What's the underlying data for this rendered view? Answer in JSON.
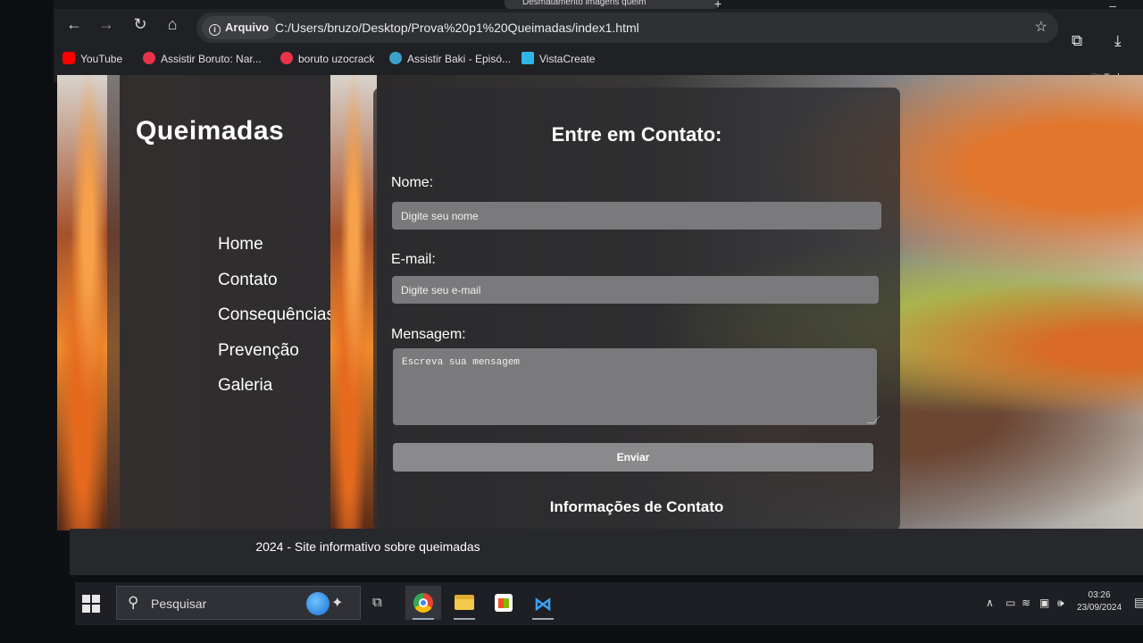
{
  "browser": {
    "tab_title": "Desmatamento imagens queim",
    "security_chip": "Arquivo",
    "url": "C:/Users/bruzo/Desktop/Prova%20p1%20Queimadas/index1.html",
    "bookmarks": [
      {
        "label": "YouTube",
        "color": "#ff0000"
      },
      {
        "label": "Assistir Boruto: Nar...",
        "color": "#e8334a"
      },
      {
        "label": "boruto uzocrack",
        "color": "#e8334a"
      },
      {
        "label": "Assistir Baki - Episó...",
        "color": "#3ba3c9"
      },
      {
        "label": "VistaCreate",
        "color": "#2fb5e8"
      }
    ],
    "other_bookmarks": "Todos os"
  },
  "site": {
    "logo": "Queimadas",
    "nav": [
      "Home",
      "Contato",
      "Consequências",
      "Prevenção",
      "Galeria"
    ],
    "form": {
      "title": "Entre em Contato:",
      "name_label": "Nome:",
      "name_placeholder": "Digite seu nome",
      "email_label": "E-mail:",
      "email_placeholder": "Digite seu e-mail",
      "message_label": "Mensagem:",
      "message_placeholder": "Escreva sua mensagem",
      "submit_label": "Enviar"
    },
    "info_title": "Informações de Contato",
    "footer": "2024 - Site informativo sobre queimadas"
  },
  "taskbar": {
    "search_placeholder": "Pesquisar",
    "time": "03:26",
    "date": "23/09/2024"
  }
}
